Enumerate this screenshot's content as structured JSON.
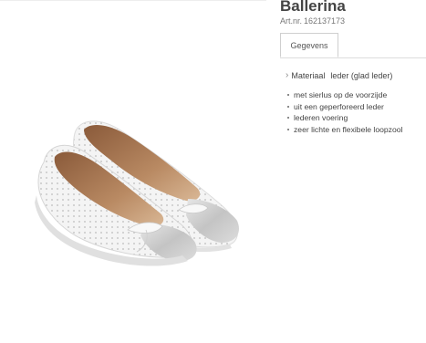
{
  "product": {
    "title": "Ballerina",
    "artnr_label": "Art.nr.",
    "artnr_value": "162137173",
    "image_icon": "ballerina-shoes-image"
  },
  "tabs": [
    {
      "label": "Gegevens",
      "active": true
    }
  ],
  "spec": {
    "label": "Materiaal",
    "value": "leder (glad leder)"
  },
  "features": [
    "met sierlus op de voorzijde",
    "uit een geperforeerd leder",
    "lederen voering",
    "zeer lichte en flexibele loopzool"
  ]
}
